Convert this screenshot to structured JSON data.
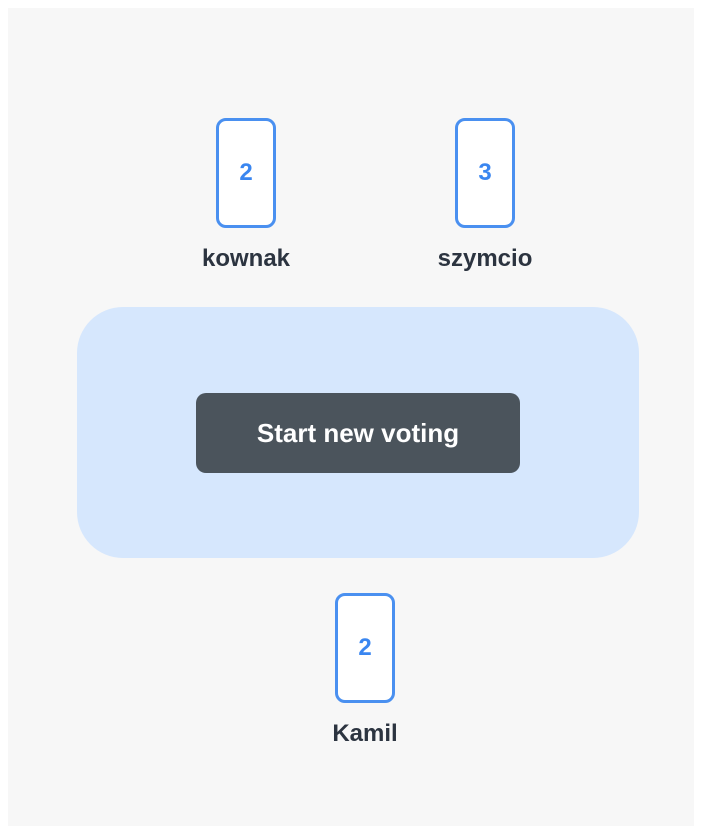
{
  "players": [
    {
      "name": "kownak",
      "card_value": "2"
    },
    {
      "name": "szymcio",
      "card_value": "3"
    },
    {
      "name": "Kamil",
      "card_value": "2"
    }
  ],
  "table": {
    "button_label": "Start new voting"
  },
  "colors": {
    "card_border": "#4a90f0",
    "card_text": "#3a86f0",
    "table_background": "#d6e7fd",
    "button_background": "#4b545c",
    "button_text": "#ffffff",
    "player_name": "#2c3440",
    "page_background": "#f7f7f7"
  }
}
